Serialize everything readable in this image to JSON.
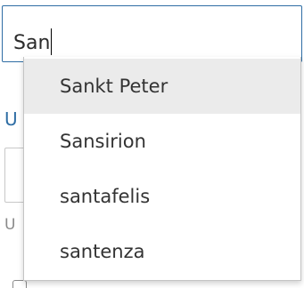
{
  "search": {
    "value": "San"
  },
  "background": {
    "label_1": "U",
    "label_2": "U"
  },
  "dropdown": {
    "items": [
      {
        "label": "Sankt Peter",
        "highlighted": true
      },
      {
        "label": "Sansirion",
        "highlighted": false
      },
      {
        "label": "santafelis",
        "highlighted": false
      },
      {
        "label": "santenza",
        "highlighted": false
      }
    ]
  },
  "colors": {
    "input_border": "#2e6da4",
    "highlight_bg": "#ebebeb",
    "text": "#333333"
  }
}
